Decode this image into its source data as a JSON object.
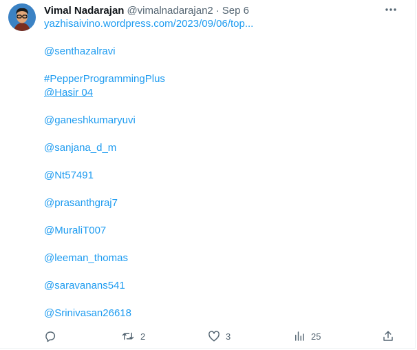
{
  "author": {
    "display_name": "Vimal Nadarajan",
    "handle": "@vimalnadarajan2",
    "separator": "·",
    "date": "Sep 6"
  },
  "tweet": {
    "link": "yazhisaivino.wordpress.com/2023/09/06/top...",
    "mentions": [
      "@senthazalravi",
      "#PepperProgrammingPlus",
      "@Hasir 04",
      "@ganeshkumaryuvi",
      "@sanjana_d_m",
      "@Nt57491",
      "@prasanthgraj7",
      "@MuraliT007",
      "@leeman_thomas",
      "@saravanans541",
      "@Srinivasan26618"
    ]
  },
  "actions": {
    "reply": {
      "icon": "reply-icon"
    },
    "retweet": {
      "icon": "retweet-icon",
      "count": "2"
    },
    "like": {
      "icon": "heart-icon",
      "count": "3"
    },
    "views": {
      "icon": "views-icon",
      "count": "25"
    },
    "share": {
      "icon": "share-icon"
    }
  },
  "colors": {
    "link": "#1d9bf0",
    "secondary_text": "#536471",
    "primary_text": "#0f1419"
  }
}
